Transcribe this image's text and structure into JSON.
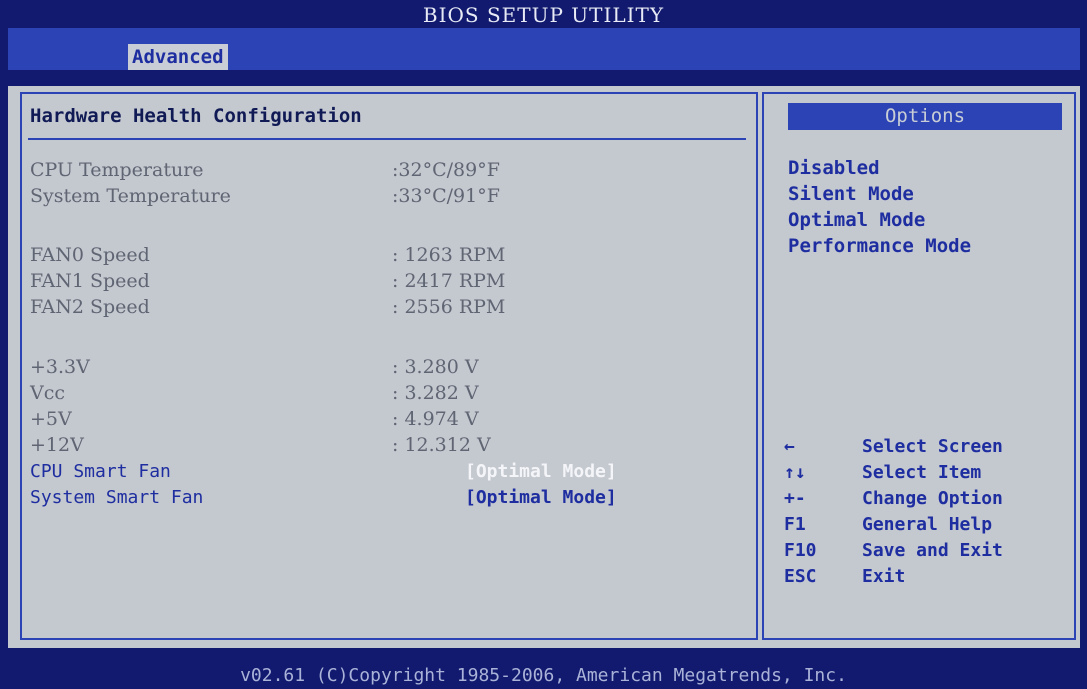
{
  "window_title": "BIOS SETUP UTILITY",
  "tabs": [
    {
      "label": "Advanced",
      "active": true
    }
  ],
  "main": {
    "section_title": "Hardware Health Configuration",
    "rows": [
      {
        "label": "CPU Temperature",
        "value": ":32°C/89°F"
      },
      {
        "label": "System Temperature",
        "value": ":33°C/91°F"
      },
      {
        "label": "FAN0 Speed",
        "value": ": 1263 RPM"
      },
      {
        "label": "FAN1 Speed",
        "value": ": 2417 RPM"
      },
      {
        "label": "FAN2 Speed",
        "value": ": 2556 RPM"
      },
      {
        "label": "+3.3V",
        "value": ": 3.280 V"
      },
      {
        "label": "Vcc",
        "value": ": 3.282 V"
      },
      {
        "label": "+5V",
        "value": ": 4.974 V"
      },
      {
        "label": "+12V",
        "value": ": 12.312 V"
      }
    ],
    "settings": [
      {
        "label": "CPU Smart Fan",
        "value": "[Optimal Mode]",
        "selected": true
      },
      {
        "label": "System Smart Fan",
        "value": "[Optimal Mode]",
        "selected": false
      }
    ]
  },
  "options_panel": {
    "header": "Options",
    "items": [
      "Disabled",
      "Silent Mode",
      "Optimal Mode",
      "Performance Mode"
    ]
  },
  "help": [
    {
      "key": "←",
      "desc": "Select Screen"
    },
    {
      "key": "↑↓",
      "desc": "Select Item"
    },
    {
      "key": "+-",
      "desc": "Change Option"
    },
    {
      "key": "F1",
      "desc": "General Help"
    },
    {
      "key": "F10",
      "desc": "Save and Exit"
    },
    {
      "key": "ESC",
      "desc": "Exit"
    }
  ],
  "footer": "v02.61 (C)Copyright 1985-2006, American Megatrends, Inc.",
  "colors": {
    "background": "#111a6e",
    "panel": "#c4c8cf",
    "accent_blue": "#2b43b4",
    "selected_text": "#f4f5f8",
    "active_text": "#1e2ea0"
  }
}
